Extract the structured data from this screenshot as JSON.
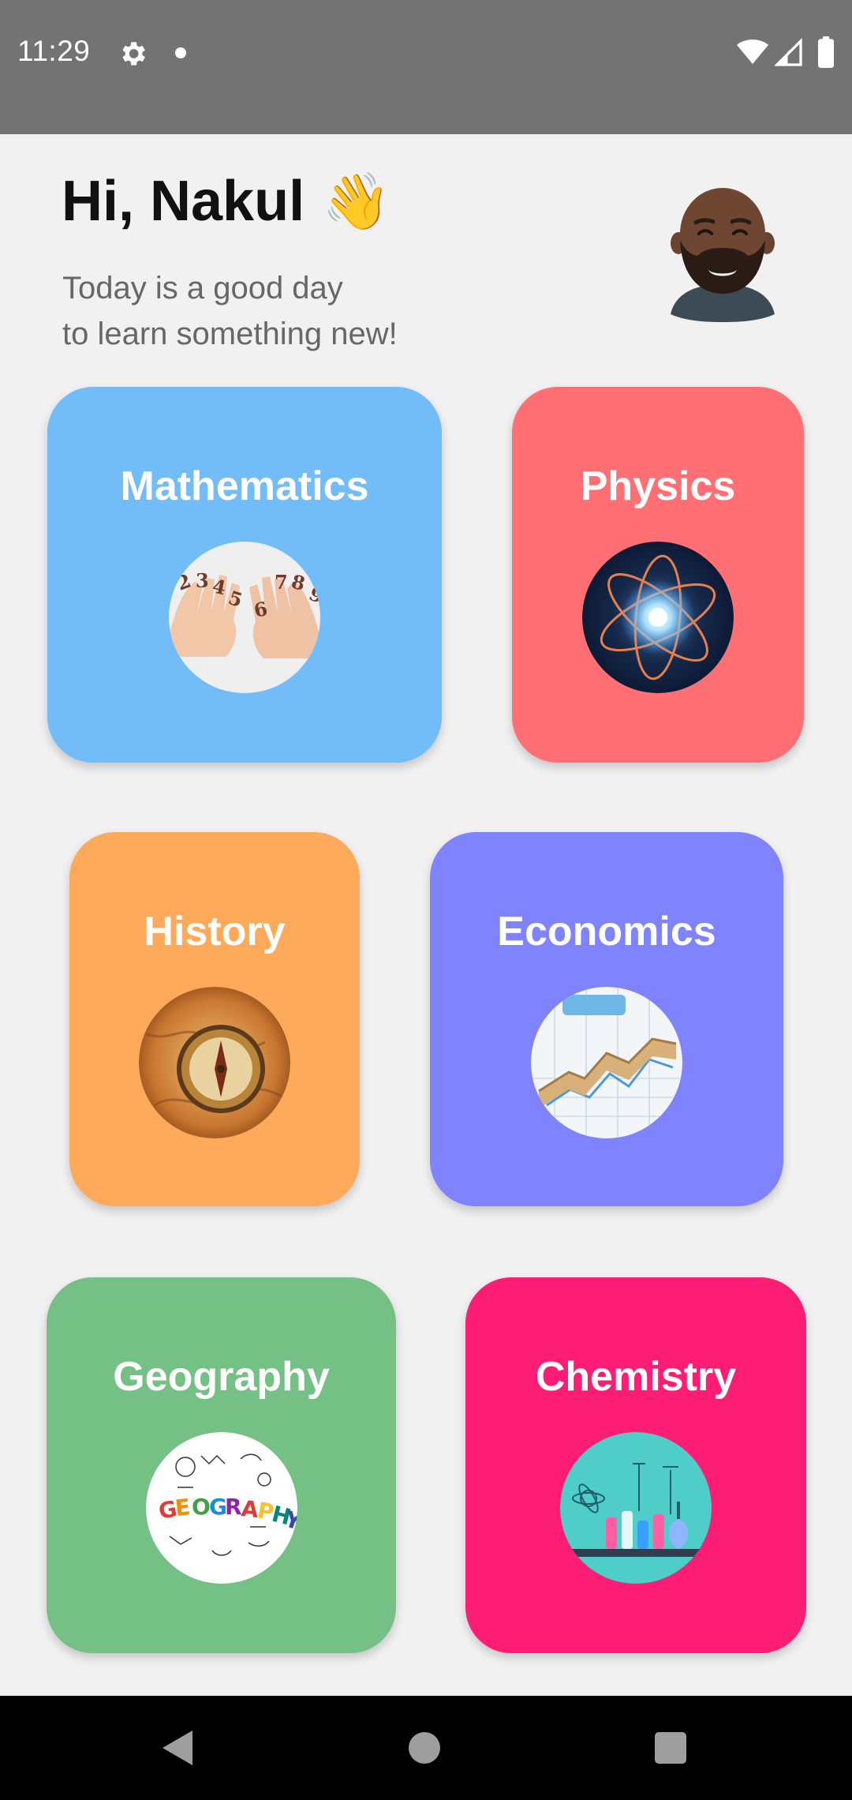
{
  "status_bar": {
    "time": "11:29",
    "icons": [
      "gear-icon",
      "notification-dot-icon",
      "wifi-icon",
      "signal-icon",
      "battery-icon"
    ]
  },
  "header": {
    "greeting": "Hi, Nakul",
    "greeting_emoji": "👋",
    "subtitle_line1": "Today is a good day",
    "subtitle_line2": "to learn something new!"
  },
  "subjects": [
    {
      "title": "Mathematics",
      "color": "#72bcf8",
      "image": "math-hands-numbers-image"
    },
    {
      "title": "Physics",
      "color": "#ff6f73",
      "image": "atom-image"
    },
    {
      "title": "History",
      "color": "#ffaa5a",
      "image": "compass-map-image"
    },
    {
      "title": "Economics",
      "color": "#7f83fe",
      "image": "chart-graph-image"
    },
    {
      "title": "Geography",
      "color": "#74c085",
      "image": "geography-doodle-image"
    },
    {
      "title": "Chemistry",
      "color": "#fd1d75",
      "image": "chemistry-lab-image"
    }
  ],
  "navigation": {
    "icons": [
      "back-icon",
      "home-icon",
      "recents-icon"
    ]
  },
  "colors": {
    "background": "#f2f1f2",
    "status_bar": "#737373",
    "nav_bar": "#000000"
  }
}
